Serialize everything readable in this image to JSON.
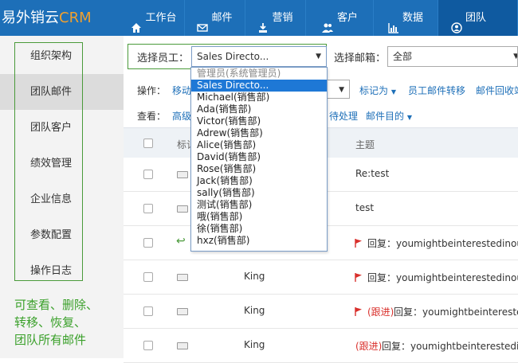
{
  "logo": {
    "text_cn": "易外销云",
    "text_en": "CRM"
  },
  "nav": [
    {
      "label": "工作台",
      "icon": "home-icon"
    },
    {
      "label": "邮件",
      "icon": "mail-icon"
    },
    {
      "label": "营销",
      "icon": "marketing-icon"
    },
    {
      "label": "客户",
      "icon": "customers-icon"
    },
    {
      "label": "数据",
      "icon": "chart-icon"
    },
    {
      "label": "团队",
      "icon": "user-circle-icon"
    }
  ],
  "sidebar": {
    "items": [
      {
        "label": "组织架构"
      },
      {
        "label": "团队邮件"
      },
      {
        "label": "团队客户"
      },
      {
        "label": "绩效管理"
      },
      {
        "label": "企业信息"
      },
      {
        "label": "参数配置"
      },
      {
        "label": "操作日志"
      }
    ],
    "note_lines": [
      "可查看、删除、",
      "转移、恢复、",
      "团队所有邮件"
    ]
  },
  "filters": {
    "employee_label": "选择员工：",
    "employee_value": "Sales Directo...",
    "mailbox_label": "选择邮箱：",
    "mailbox_value": "全部"
  },
  "operations": {
    "label": "操作：",
    "move": "移动",
    "mark_as": "标记为",
    "transfer": "员工邮件转移",
    "recycle": "邮件回收站"
  },
  "view": {
    "label": "查看：",
    "advanced": "高级",
    "pending": "待处理",
    "purpose": "邮件目的"
  },
  "table": {
    "col_mark": "标记",
    "col_subject": "主题",
    "rows": [
      {
        "sender": "",
        "prefix": "",
        "subject": "Re:test",
        "flag": false,
        "reply_icon": false
      },
      {
        "sender": "",
        "prefix": "",
        "subject": "test",
        "flag": false,
        "reply_icon": false
      },
      {
        "sender": "",
        "prefix": "",
        "subject": "回复：youmightbeinterestedinou",
        "flag": true,
        "reply_icon": true
      },
      {
        "sender": "King",
        "prefix": "",
        "subject": "回复：youmightbeinterestedinou",
        "flag": true,
        "reply_icon": false
      },
      {
        "sender": "King",
        "prefix": "(跟进)",
        "subject": "回复：youmightbeintereste",
        "flag": true,
        "reply_icon": false
      },
      {
        "sender": "King",
        "prefix": "(跟进)",
        "subject": "回复：youmightbeinterestedin",
        "flag": false,
        "reply_icon": false
      }
    ]
  },
  "dropdown": {
    "options": [
      {
        "label": "管理员(系统管理员)",
        "state": "disabled"
      },
      {
        "label": "Sales Directo...",
        "state": "selected"
      },
      {
        "label": "Michael(销售部)",
        "state": ""
      },
      {
        "label": "Ada(销售部)",
        "state": ""
      },
      {
        "label": "Victor(销售部)",
        "state": ""
      },
      {
        "label": "Adrew(销售部)",
        "state": ""
      },
      {
        "label": "Alice(销售部)",
        "state": ""
      },
      {
        "label": "David(销售部)",
        "state": ""
      },
      {
        "label": "Rose(销售部)",
        "state": ""
      },
      {
        "label": "Jack(销售部)",
        "state": ""
      },
      {
        "label": "sally(销售部)",
        "state": ""
      },
      {
        "label": "测试(销售部)",
        "state": ""
      },
      {
        "label": "哦(销售部)",
        "state": ""
      },
      {
        "label": "徐(销售部)",
        "state": ""
      },
      {
        "label": "hxz(销售部)",
        "state": ""
      }
    ]
  },
  "colors": {
    "brand": "#1d6fb8",
    "accent": "#f0a030",
    "note_green": "#3aa02a",
    "flag_red": "#d9302c"
  }
}
